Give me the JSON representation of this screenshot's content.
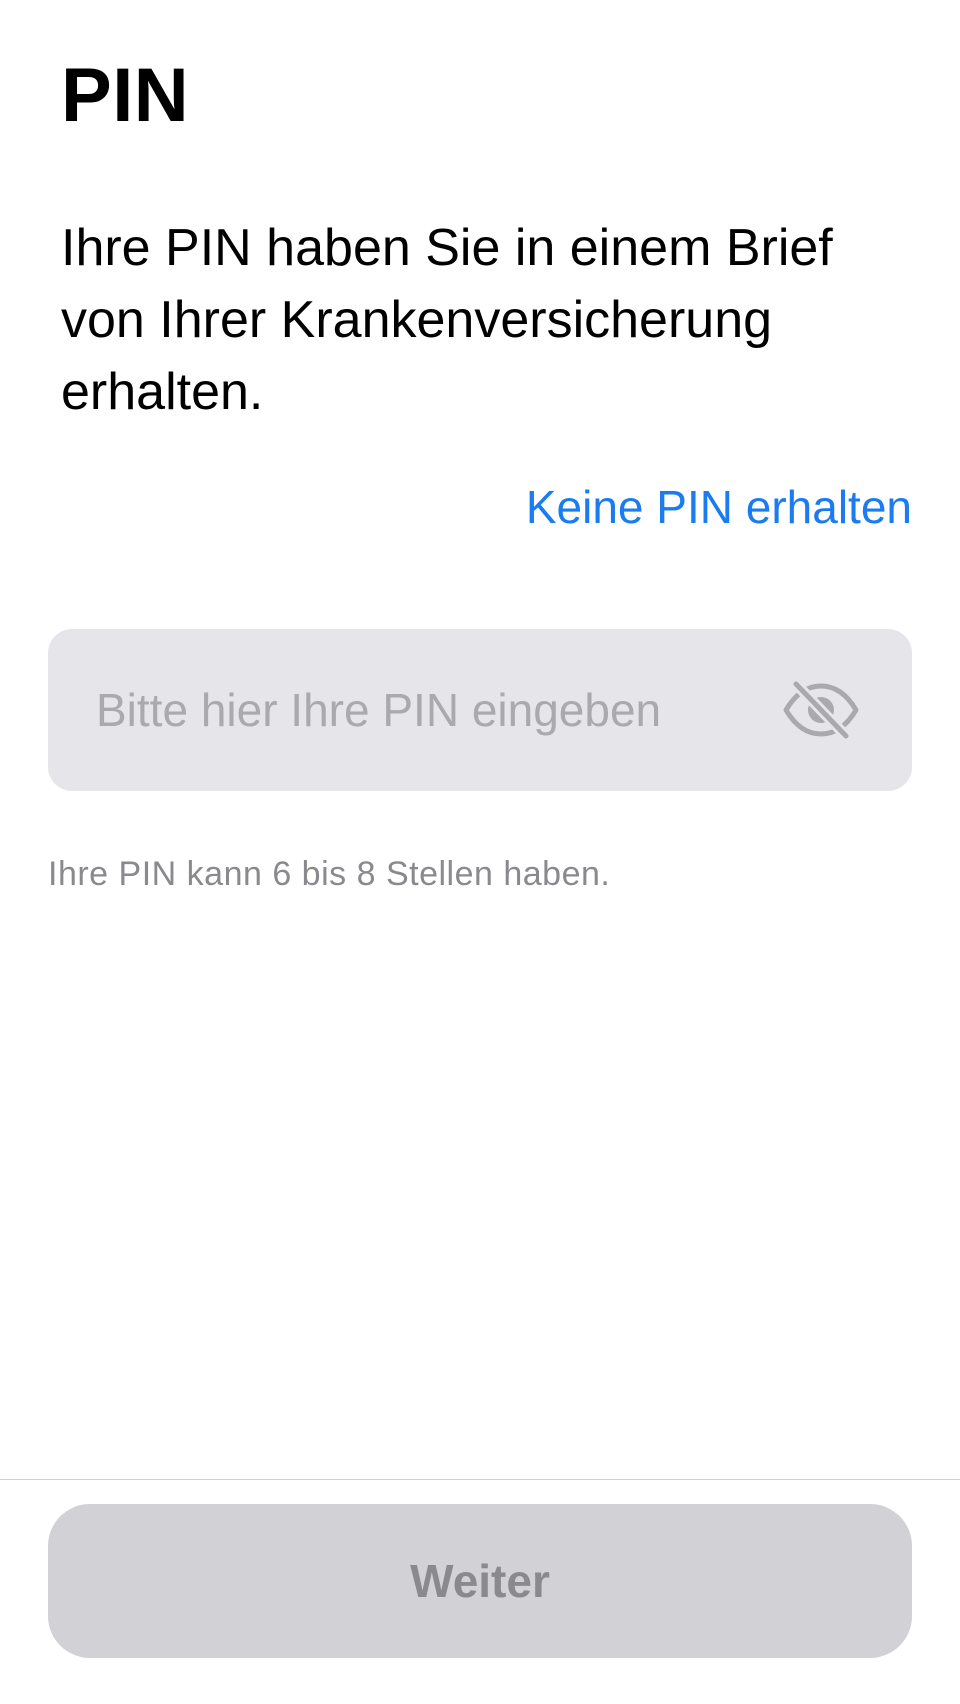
{
  "header": {
    "title": "PIN"
  },
  "main": {
    "description": "Ihre PIN haben Sie in einem Brief von Ihrer Krankenversicherung erhalten.",
    "no_pin_link": "Keine PIN erhalten",
    "pin_input": {
      "value": "",
      "placeholder": "Bitte hier Ihre PIN eingeben",
      "visibility_icon": "eye-slash-icon"
    },
    "hint": "Ihre PIN kann 6 bis 8 Stellen haben."
  },
  "footer": {
    "continue_label": "Weiter"
  },
  "colors": {
    "accent": "#1a7cf0",
    "field_background": "#e5e5ea",
    "button_disabled_background": "#d1d1d6",
    "secondary_text": "#8a8a8e"
  }
}
